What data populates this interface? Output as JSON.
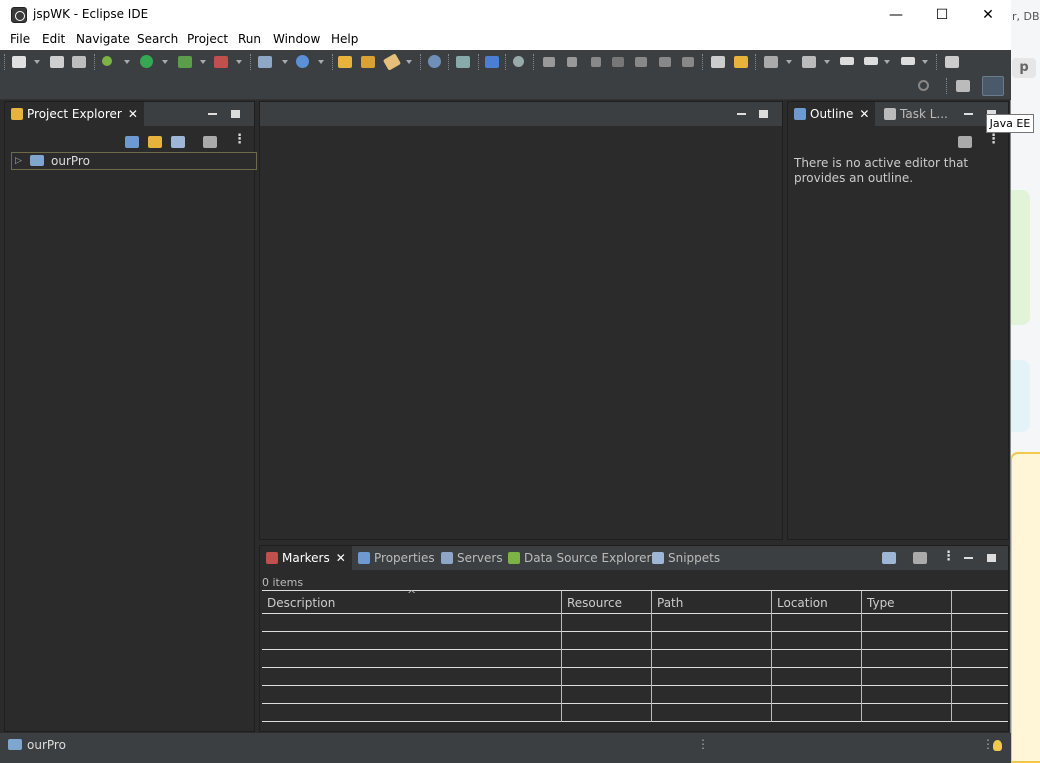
{
  "window": {
    "title": "jspWK - Eclipse IDE"
  },
  "window_controls": {
    "minimize": "—",
    "maximize": "☐",
    "close": "✕"
  },
  "menu": [
    "File",
    "Edit",
    "Navigate",
    "Search",
    "Project",
    "Run",
    "Window",
    "Help"
  ],
  "background_text": "r, DB.",
  "background_letter": "p",
  "project_explorer": {
    "tab_label": "Project Explorer",
    "tree": [
      {
        "label": "ourPro",
        "expand_glyph": "▷"
      }
    ]
  },
  "outline": {
    "tab_label": "Outline",
    "second_tab_label": "Task L...",
    "message": "There is no active editor that provides an outline."
  },
  "tooltip": "Java EE",
  "bottom_tabs": {
    "markers": "Markers",
    "properties": "Properties",
    "servers": "Servers",
    "data_source_explorer": "Data Source Explorer",
    "snippets": "Snippets"
  },
  "markers": {
    "count_text": "0 items",
    "columns": [
      "Description",
      "Resource",
      "Path",
      "Location",
      "Type"
    ],
    "sort_glyph": "^"
  },
  "status": {
    "text": "ourPro"
  },
  "colors": {
    "background": "#2b2b2b",
    "toolbar": "#3c3f41",
    "run_green": "#34a853",
    "folder_yellow": "#e8b33a",
    "bulb_yellow": "#f2c94c"
  }
}
